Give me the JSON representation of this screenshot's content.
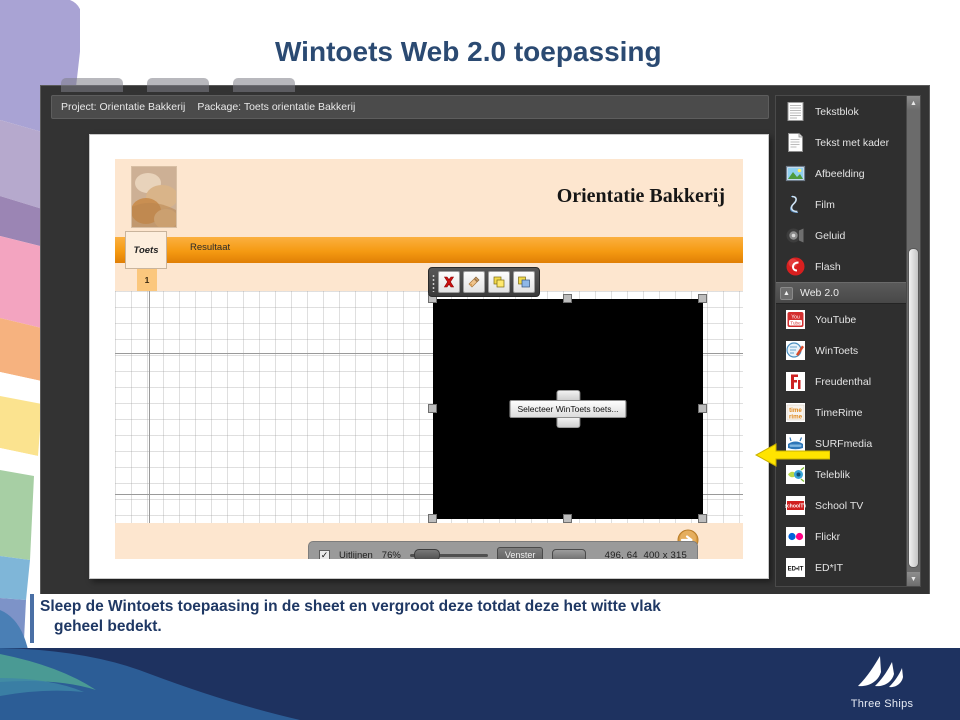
{
  "slide": {
    "title": "Wintoets Web 2.0 toepassing",
    "caption_line1": "Sleep de Wintoets toepaasing in de sheet en vergroot deze totdat deze het witte vlak",
    "caption_line2": "geheel bedekt.",
    "title_color": "#2b4a72",
    "caption_color": "#1f3864"
  },
  "app": {
    "project_label": "Project: Orientatie Bakkerij",
    "package_label": "Package: Toets orientatie Bakkerij"
  },
  "canvas": {
    "slide_title": "Orientatie Bakkerij",
    "tab_toets": "Toets",
    "tab_resultaat": "Resultaat",
    "page_number": "1",
    "select_button": "Selecteer WinToets toets...",
    "toolbar": [
      {
        "name": "delete-icon",
        "glyph": "✖"
      },
      {
        "name": "edit-hand-icon",
        "glyph": "☛"
      },
      {
        "name": "copy-icon",
        "glyph": "❐"
      },
      {
        "name": "paste-icon",
        "glyph": "❏"
      }
    ],
    "next_button_icon": "arrow-right-circle-icon"
  },
  "statusbar": {
    "align_label": "Uitlijnen",
    "align_checked": true,
    "zoom_value": "76%",
    "window_button": "Venster",
    "coordinates": "496, 64",
    "dimensions": "400 x 315"
  },
  "panel": {
    "items_top": [
      {
        "label": "Tekstblok",
        "icon": "text-block-icon"
      },
      {
        "label": "Tekst met kader",
        "icon": "text-framed-icon"
      },
      {
        "label": "Afbeelding",
        "icon": "image-icon"
      },
      {
        "label": "Film",
        "icon": "film-icon"
      },
      {
        "label": "Geluid",
        "icon": "sound-icon"
      },
      {
        "label": "Flash",
        "icon": "flash-icon"
      }
    ],
    "section_label": "Web 2.0",
    "items_web": [
      {
        "label": "YouTube",
        "icon": "youtube-icon"
      },
      {
        "label": "WinToets",
        "icon": "wintoets-icon"
      },
      {
        "label": "Freudenthal",
        "icon": "freudenthal-icon"
      },
      {
        "label": "TimeRime",
        "icon": "timerime-icon"
      },
      {
        "label": "SURFmedia",
        "icon": "surfmedia-icon"
      },
      {
        "label": "Teleblik",
        "icon": "teleblik-icon"
      },
      {
        "label": "School TV",
        "icon": "schooltv-icon"
      },
      {
        "label": "Flickr",
        "icon": "flickr-icon"
      },
      {
        "label": "ED*IT",
        "icon": "edit-icon"
      }
    ]
  },
  "branding": {
    "logo_text": "Three Ships"
  }
}
